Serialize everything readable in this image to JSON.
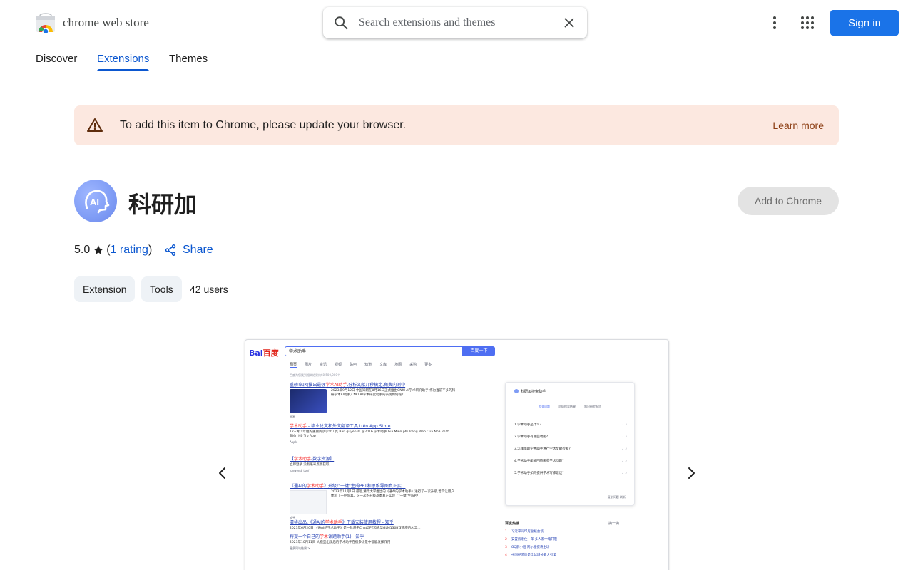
{
  "header": {
    "brand": "chrome web store",
    "search_placeholder": "Search extensions and themes",
    "sign_in": "Sign in"
  },
  "tabs": [
    {
      "label": "Discover"
    },
    {
      "label": "Extensions",
      "active": true
    },
    {
      "label": "Themes"
    }
  ],
  "banner": {
    "message": "To add this item to Chrome, please update your browser.",
    "learn_more": "Learn more"
  },
  "item": {
    "title": "科研加",
    "add_button": "Add to Chrome",
    "rating_value": "5.0",
    "rating_open": "(",
    "rating_link": "1 rating",
    "rating_close": ")",
    "share": "Share",
    "chips": [
      "Extension",
      "Tools"
    ],
    "users": "42 users"
  },
  "screenshot": {
    "logo_a": "Bai",
    "logo_b": "百度",
    "query": "学术助手",
    "search_btn": "百度一下",
    "nav": [
      "网页",
      "图片",
      "资讯",
      "视频",
      "贴吧",
      "知道",
      "文库",
      "地图",
      "采购",
      "更多"
    ],
    "sub": "百度为您找到相关结果约60,500,000个",
    "results": [
      {
        "t1": "重磅!知网推出最强",
        "em": "学术AI助手",
        "t2": ",分析文献几秒搞定,免费内测中",
        "d": "2023年9月12日 中国知网在8月16日正式推出CNKI AI学术研究助手,作为当前不多的科研学术AI助手,CNKI AI学术研究助手的表现如何呢?",
        "src": "网易"
      },
      {
        "t1": "",
        "em": "学术助手",
        "t2": " - 毕业论文和外文翻译工具 trên App Store",
        "d": "12+青少年组的重要阅读学术工具 Bản quyền © @2016 学术助手 Giá Miễn phí Trang Web Của Nhà Phát Triển Hỗ Trợ App",
        "src": "Apple"
      },
      {
        "t1": "【",
        "em": "学术助手",
        "t2": "-数字资源】",
        "d": "立即登录 没有账号点此获取",
        "src": "lunwendi top/"
      },
      {
        "t1": "《通AI的",
        "em": "学术助手",
        "t2": "》升级!\"一键\"生成PPT和思维导图真正实...",
        "d": "2023年11月1日 最近,清华大学推出的《通AI的学术助手》进行了一次升级,着实让用户体验了一把惊喜。这一次的升级基本真正实现了\"一键\"生成PPT",
        "src": "知乎"
      },
      {
        "t1": "清华出品,《通AI的",
        "em": "学术助手",
        "t2": "》下载安装使用教程 - 知乎",
        "d": "2023年6月20日 《通AI的学术助手》是一款基于ChatGPT和清华GLM130B双底座的AI工...",
        "src": ""
      },
      {
        "t1": "捋提一个自己的",
        "em": "学术",
        "t2": "课题助手(1) - 知乎",
        "d": "2023年10月11日 大模型出现后的学术助手在很多场景中都能发挥作用",
        "src": "更多同站结果 >"
      }
    ],
    "panel_title": "科研加搜索助手",
    "panel_tabs": [
      "相关问题",
      "总结搜索结果",
      "知识研究报告"
    ],
    "questions": [
      "1.学术助手是什么?",
      "2.学术助手有哪些功能?",
      "3.怎样借助学术助手进行学术文献检索?",
      "4.学术助手能够回答哪些学术问题?",
      "5.学术助手如何提供学术写作建议?"
    ],
    "panel_footer": "复制问题   刷新",
    "hot_title": "百度热搜",
    "hot_refresh": "换一换",
    "hot_items": [
      "习近平同印尼总统会谈",
      "安置房刚住一年 多人家中墙开裂",
      "GQ前小姐 阿尔塞提将主场",
      "中国经济仍是全球增长最大引擎"
    ]
  }
}
